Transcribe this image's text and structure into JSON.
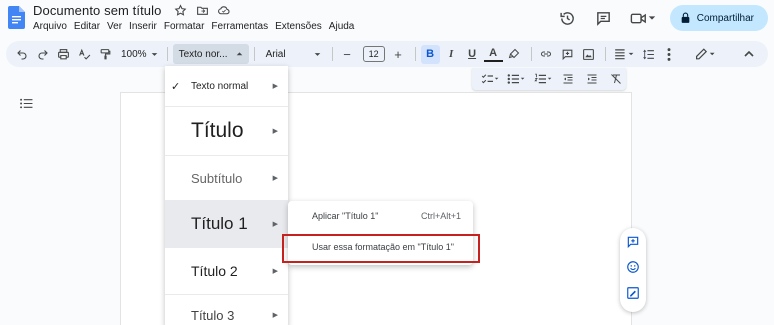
{
  "header": {
    "title": "Documento sem título",
    "menu": [
      "Arquivo",
      "Editar",
      "Ver",
      "Inserir",
      "Formatar",
      "Ferramentas",
      "Extensões",
      "Ajuda"
    ],
    "share_label": "Compartilhar",
    "brand_color": "#4285f4",
    "share_bg": "#c2e7ff"
  },
  "toolbar": {
    "zoom": "100%",
    "style": "Texto nor...",
    "font": "Arial",
    "font_size": "12",
    "text_color_glyph": "A",
    "bold_glyph": "B",
    "italic_glyph": "I",
    "underline_glyph": "U",
    "minus_glyph": "−",
    "plus_glyph": "+"
  },
  "style_menu": {
    "items": [
      {
        "label": "Texto normal",
        "checked": true
      },
      {
        "label": "Título"
      },
      {
        "label": "Subtítulo"
      },
      {
        "label": "Título 1",
        "active": true
      },
      {
        "label": "Título 2"
      },
      {
        "label": "Título 3"
      }
    ],
    "check_glyph": "✓",
    "arrow_glyph": "▶"
  },
  "submenu": {
    "items": [
      {
        "label": "Aplicar \"Título 1\"",
        "shortcut": "Ctrl+Alt+1"
      },
      {
        "label": "Usar essa formatação em \"Título 1\""
      }
    ],
    "highlight_color": "#c5221f"
  }
}
